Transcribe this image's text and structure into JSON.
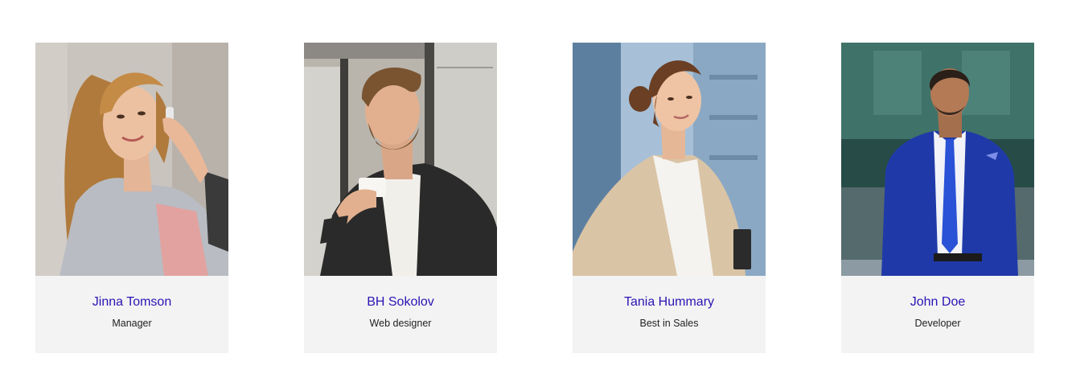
{
  "team": {
    "members": [
      {
        "name": "Jinna Tomson",
        "role": "Manager"
      },
      {
        "name": "BH Sokolov",
        "role": "Web designer"
      },
      {
        "name": "Tania Hummary",
        "role": "Best in Sales"
      },
      {
        "name": "John Doe",
        "role": "Developer"
      }
    ]
  },
  "colors": {
    "name_link": "#2a14b4",
    "card_background": "#f3f3f3",
    "role_text": "#222222"
  }
}
